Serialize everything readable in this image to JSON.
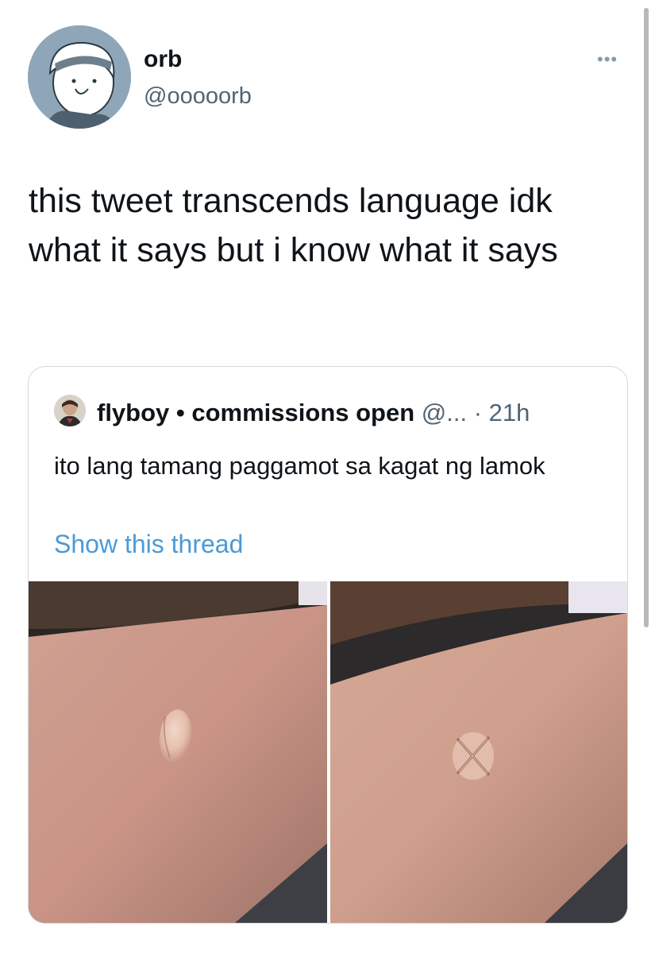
{
  "tweet": {
    "author_name": "orb",
    "author_handle": "@ooooorb",
    "more_icon": "more-options-icon",
    "text": "this tweet transcends language idk what it says but i know what it says"
  },
  "quoted_tweet": {
    "author_name": "flyboy • commissions open",
    "meta": "@... · 21h",
    "text": "ito lang tamang paggamot sa kagat ng lamok",
    "show_thread_label": "Show this thread",
    "photos": [
      "mosquito-bite-photo",
      "mosquito-bite-x-photo"
    ]
  },
  "colors": {
    "link": "#4a9ad8",
    "handle": "#536471",
    "border": "#cfd9de"
  }
}
